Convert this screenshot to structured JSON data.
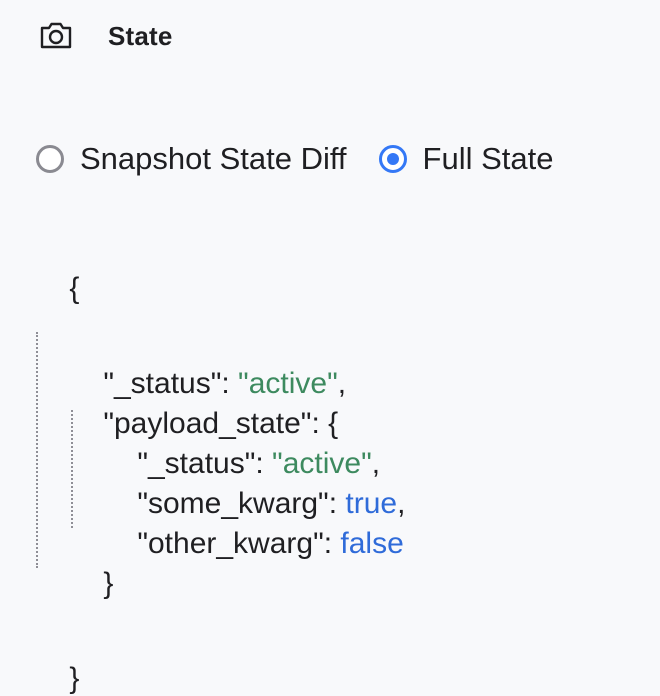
{
  "header": {
    "icon": "camera-icon",
    "title": "State"
  },
  "view_mode": {
    "options": [
      {
        "label": "Snapshot State Diff",
        "selected": false
      },
      {
        "label": "Full State",
        "selected": true
      }
    ]
  },
  "state": {
    "open_brace": "{",
    "close_brace": "}",
    "status_key": "\"_status\"",
    "status_value": "\"active\"",
    "payload_key": "\"payload_state\"",
    "payload_open": "{",
    "payload_close": "}",
    "payload": {
      "status_key": "\"_status\"",
      "status_value": "\"active\"",
      "some_kwarg_key": "\"some_kwarg\"",
      "some_kwarg_value": "true",
      "other_kwarg_key": "\"other_kwarg\"",
      "other_kwarg_value": "false"
    }
  },
  "colors": {
    "accent": "#3478f6",
    "string": "#3d8a5f",
    "boolean": "#2f6bd9",
    "background": "#f8f9fb"
  }
}
